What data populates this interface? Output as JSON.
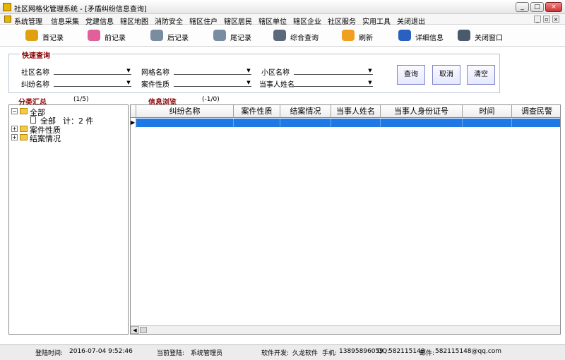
{
  "window": {
    "title": "社区网格化管理系统 - [矛盾纠纷信息查询]",
    "controls": [
      "_",
      "□",
      "×"
    ]
  },
  "menu": {
    "items": [
      "系统管理",
      "信息采集",
      "党建信息",
      "辖区地图",
      "消防安全",
      "辖区住户",
      "辖区居民",
      "辖区单位",
      "辖区企业",
      "社区服务",
      "实用工具",
      "关闭退出"
    ],
    "controls": [
      "_",
      "▫",
      "×"
    ]
  },
  "toolbar": {
    "buttons": [
      {
        "label": "首记录",
        "icon": "first-record-icon",
        "color": "#e0a010"
      },
      {
        "label": "前记录",
        "icon": "prev-record-icon",
        "color": "#e0609a"
      },
      {
        "label": "后记录",
        "icon": "next-record-icon",
        "color": "#7a8ca0"
      },
      {
        "label": "尾记录",
        "icon": "last-record-icon",
        "color": "#7a8ca0"
      },
      {
        "label": "综合查询",
        "icon": "search-icon",
        "color": "#5a6a7a"
      },
      {
        "label": "刷新",
        "icon": "refresh-icon",
        "color": "#f0a020"
      },
      {
        "label": "详细信息",
        "icon": "detail-icon",
        "color": "#2a60c0"
      },
      {
        "label": "关闭窗口",
        "icon": "close-window-icon",
        "color": "#4a5a6a"
      }
    ]
  },
  "quick_query": {
    "title": "快速查询",
    "fields": [
      {
        "label": "社区名称",
        "value": ""
      },
      {
        "label": "网格名称",
        "value": ""
      },
      {
        "label": "小区名称",
        "value": ""
      },
      {
        "label": "纠纷名称",
        "value": ""
      },
      {
        "label": "案件性质",
        "value": ""
      },
      {
        "label": "当事人姓名",
        "value": ""
      }
    ],
    "buttons": {
      "query": "查询",
      "cancel": "取消",
      "clear": "清空"
    }
  },
  "category": {
    "title": "分类汇总",
    "count": "(1/5)",
    "tree": {
      "root": "全部",
      "child_label": "全部",
      "child_count": "计：2 件",
      "nodes": [
        "案件性质",
        "结案情况"
      ]
    }
  },
  "browse": {
    "title": "信息浏览",
    "count": "(-1/0)",
    "columns": [
      "纠纷名称",
      "案件性质",
      "结案情况",
      "当事人姓名",
      "当事人身份证号",
      "时间",
      "调查民警"
    ]
  },
  "status": {
    "login_time_label": "登陆时间:",
    "login_time": "2016-07-04 9:52:46",
    "current_user_label": "当前登陆:",
    "current_user": "系统管理员",
    "developer_label": "软件开发:",
    "developer": "久龙软件",
    "phone_label": "手机:",
    "phone": "13895896059",
    "qq_label": "QQ:",
    "qq": "582115148",
    "email_label": "邮件:",
    "email": "582115148@qq.com"
  }
}
